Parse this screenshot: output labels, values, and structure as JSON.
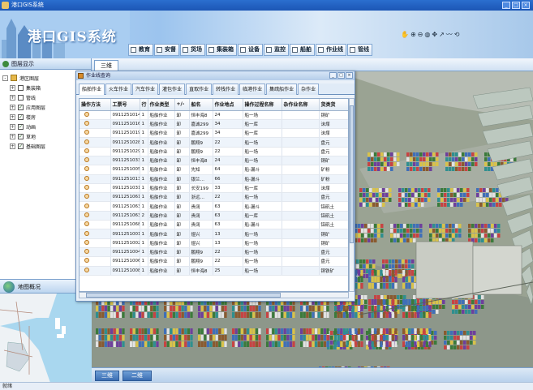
{
  "window": {
    "title": "港口GIS系统",
    "buttons": [
      "_",
      "□",
      "×"
    ]
  },
  "banner": {
    "logo": "港口GIS系统"
  },
  "menu": [
    "教育",
    "安督",
    "货场",
    "集装箱",
    "设备",
    "监控",
    "船舶",
    "作业线",
    "管线"
  ],
  "toolbar_icons": [
    "hand-icon",
    "zoom-in-icon",
    "zoom-out-icon",
    "globe-icon",
    "pan-icon",
    "measure-icon",
    "wave-icon",
    "reset-icon"
  ],
  "left_panel": {
    "title": "图层显示",
    "tree": [
      {
        "label": "港区图层",
        "expand": "-",
        "checked": false,
        "level": 0
      },
      {
        "label": "集装箱",
        "expand": "+",
        "checked": false,
        "level": 1
      },
      {
        "label": "管线",
        "expand": "+",
        "checked": false,
        "level": 1
      },
      {
        "label": "应用图层",
        "expand": "+",
        "checked": true,
        "level": 1
      },
      {
        "label": "楼房",
        "expand": "+",
        "checked": true,
        "level": 1
      },
      {
        "label": "动画",
        "expand": "+",
        "checked": true,
        "level": 1
      },
      {
        "label": "草地",
        "expand": "+",
        "checked": true,
        "level": 1
      },
      {
        "label": "基础图层",
        "expand": "+",
        "checked": true,
        "level": 1
      }
    ],
    "overview_title": "地图概况"
  },
  "view_tab": "三维",
  "bottom_tabs": [
    "三维",
    "二维"
  ],
  "status": "就绪",
  "dialog": {
    "title": "作业线查询",
    "tabs": [
      "船舶作业",
      "火车作业",
      "汽车作业",
      "灌包作业",
      "直取作业",
      "转栈作业",
      "临港作业",
      "集疏船作业",
      "杂作业"
    ],
    "columns": [
      "操作方法",
      "工票号",
      "行",
      "作业类型",
      "+/-",
      "船名",
      "作业地点",
      "操作过程名称",
      "杂作业名称",
      "货类货"
    ],
    "rows": [
      [
        "",
        "0911251014",
        "1",
        "船舶作业",
        "卸",
        "恒丰海8",
        "24",
        "船一场",
        "",
        "铜矿"
      ],
      [
        "",
        "0911251016",
        "1",
        "船舶作业",
        "卸",
        "嘉诚299",
        "34",
        "船一库",
        "",
        "沫煤"
      ],
      [
        "",
        "0911251019",
        "1",
        "船舶作业",
        "卸",
        "嘉诚299",
        "34",
        "船一库",
        "",
        "沫煤"
      ],
      [
        "",
        "0911251028",
        "1",
        "船舶作业",
        "卸",
        "鹏翔9",
        "22",
        "船一场",
        "",
        "盘元"
      ],
      [
        "",
        "0911251029",
        "1",
        "船舶作业",
        "卸",
        "鹏翔9",
        "22",
        "船一场",
        "",
        "盘元"
      ],
      [
        "",
        "0911251033",
        "1",
        "船舶作业",
        "卸",
        "恒丰海8",
        "24",
        "船一场",
        "",
        "铜矿"
      ],
      [
        "",
        "0911251005",
        "1",
        "船舶作业",
        "卸",
        "先知",
        "64",
        "船-漏斗",
        "",
        "矿粉"
      ],
      [
        "",
        "0911251013",
        "1",
        "船舶作业",
        "卸",
        "银兰…",
        "66",
        "船-漏斗",
        "",
        "矿粉"
      ],
      [
        "",
        "0911251031",
        "1",
        "船舶作业",
        "卸",
        "长安199",
        "33",
        "船一库",
        "",
        "沫煤"
      ],
      [
        "",
        "0911251061",
        "1",
        "船舶作业",
        "卸",
        "浙远…",
        "22",
        "船一场",
        "",
        "盘元"
      ],
      [
        "",
        "0911251063",
        "1",
        "船舶作业",
        "卸",
        "贵阔",
        "63",
        "船-漏斗",
        "",
        "铝矾土"
      ],
      [
        "",
        "0911251063",
        "2",
        "船舶作业",
        "卸",
        "贵阔",
        "63",
        "船一库",
        "",
        "铝矾土"
      ],
      [
        "",
        "0911251068",
        "1",
        "船舶作业",
        "卸",
        "贵阔",
        "63",
        "船-漏斗",
        "",
        "铝矾土"
      ],
      [
        "",
        "0911251001",
        "1",
        "船舶作业",
        "卸",
        "煜兴",
        "13",
        "船一场",
        "",
        "铜矿"
      ],
      [
        "",
        "0911251002",
        "1",
        "船舶作业",
        "卸",
        "煜兴",
        "13",
        "船一场",
        "",
        "铜矿"
      ],
      [
        "",
        "0911251004",
        "1",
        "船舶作业",
        "卸",
        "鹏翔9",
        "22",
        "船一场",
        "",
        "盘元"
      ],
      [
        "",
        "0911251006",
        "1",
        "船舶作业",
        "卸",
        "鹏翔9",
        "22",
        "船一场",
        "",
        "盘元"
      ],
      [
        "",
        "0911251008",
        "1",
        "船舶作业",
        "卸",
        "恒丰海8",
        "25",
        "船一场",
        "",
        "铜铁矿"
      ]
    ]
  },
  "colors": {
    "accent": "#1c56b5",
    "grid_alt": "#eef4fb",
    "terrain": "#9aa393"
  }
}
